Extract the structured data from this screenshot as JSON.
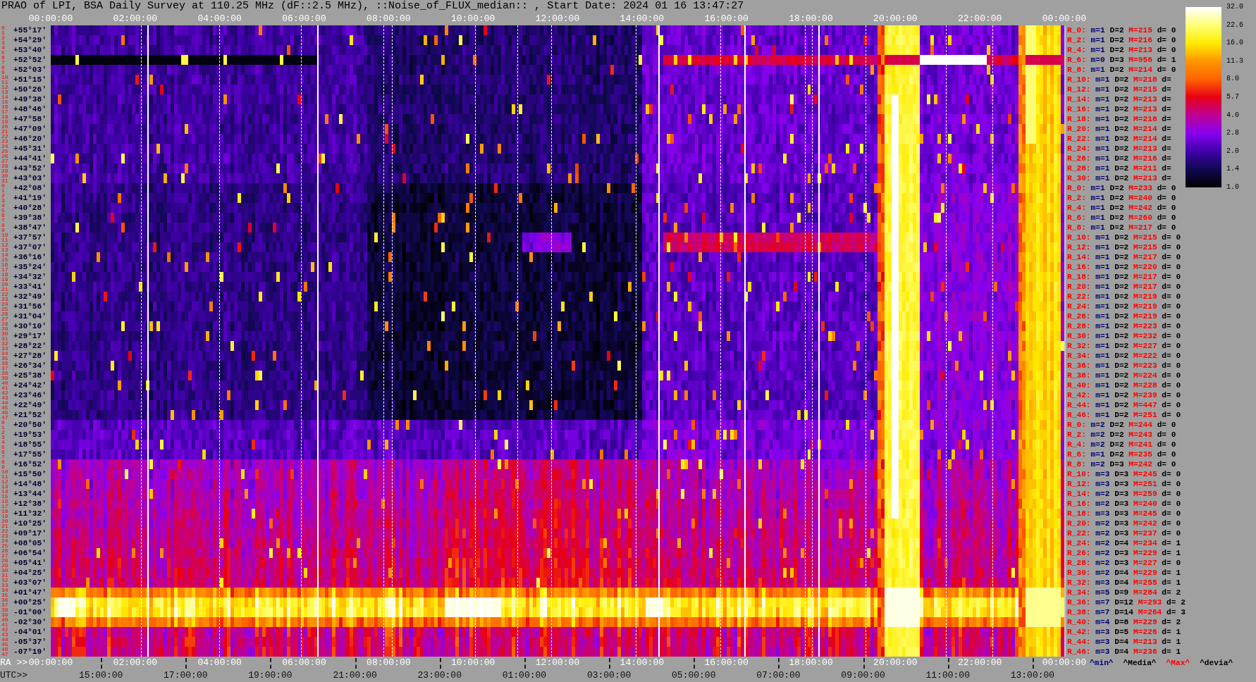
{
  "title": "PRAO of LPI, BSA Daily Survey at 110.25 MHz (dF::2.5 MHz), ::Noise_of_FLUX_median:: , Start Date: 2024 01 16 13:47:27",
  "top_axis": {
    "labels": [
      "00:00:00",
      "02:00:00",
      "04:00:00",
      "06:00:00",
      "08:00:00",
      "10:00:00",
      "12:00:00",
      "14:00:00",
      "16:00:00",
      "18:00:00",
      "20:00:00",
      "22:00:00",
      "00:00:00"
    ]
  },
  "declination_axis": [
    {
      "indices": [
        "0",
        "1"
      ],
      "label": "+55°17'"
    },
    {
      "indices": [
        "2",
        "3"
      ],
      "label": "+54°29'"
    },
    {
      "indices": [
        "4",
        "5"
      ],
      "label": "+53°40'"
    },
    {
      "indices": [
        "6",
        "7"
      ],
      "label": "+52°52'"
    },
    {
      "indices": [
        "8",
        "9"
      ],
      "label": "+52°03'"
    },
    {
      "indices": [
        "10",
        "11"
      ],
      "label": "+51°15'"
    },
    {
      "indices": [
        "12",
        "13"
      ],
      "label": "+50°26'"
    },
    {
      "indices": [
        "14",
        "15"
      ],
      "label": "+49°38'"
    },
    {
      "indices": [
        "16",
        "17"
      ],
      "label": "+48°46'"
    },
    {
      "indices": [
        "18",
        "19"
      ],
      "label": "+47°58'"
    },
    {
      "indices": [
        "20",
        "21"
      ],
      "label": "+47°09'"
    },
    {
      "indices": [
        "22",
        "23"
      ],
      "label": "+46°20'"
    },
    {
      "indices": [
        "24",
        "25"
      ],
      "label": "+45°31'"
    },
    {
      "indices": [
        "26",
        "27"
      ],
      "label": "+44°41'"
    },
    {
      "indices": [
        "28",
        "29"
      ],
      "label": "+43°52'"
    },
    {
      "indices": [
        "30",
        "31"
      ],
      "label": "+43°03'"
    },
    {
      "indices": [
        "0",
        "1"
      ],
      "label": "+42°08'"
    },
    {
      "indices": [
        "2",
        "3"
      ],
      "label": "+41°19'"
    },
    {
      "indices": [
        "4",
        "5"
      ],
      "label": "+40°28'"
    },
    {
      "indices": [
        "6",
        "7"
      ],
      "label": "+39°38'"
    },
    {
      "indices": [
        "8",
        "9"
      ],
      "label": "+38°47'"
    },
    {
      "indices": [
        "10",
        "11"
      ],
      "label": "+37°57'"
    },
    {
      "indices": [
        "12",
        "13"
      ],
      "label": "+37°07'"
    },
    {
      "indices": [
        "14",
        "15"
      ],
      "label": "+36°16'"
    },
    {
      "indices": [
        "16",
        "17"
      ],
      "label": "+35°24'"
    },
    {
      "indices": [
        "18",
        "19"
      ],
      "label": "+34°32'"
    },
    {
      "indices": [
        "20",
        "21"
      ],
      "label": "+33°41'"
    },
    {
      "indices": [
        "22",
        "23"
      ],
      "label": "+32°49'"
    },
    {
      "indices": [
        "24",
        "25"
      ],
      "label": "+31°56'"
    },
    {
      "indices": [
        "26",
        "27"
      ],
      "label": "+31°04'"
    },
    {
      "indices": [
        "28",
        "29"
      ],
      "label": "+30°10'"
    },
    {
      "indices": [
        "30",
        "31"
      ],
      "label": "+29°17'"
    },
    {
      "indices": [
        "32",
        "33"
      ],
      "label": "+28°22'"
    },
    {
      "indices": [
        "34",
        "35"
      ],
      "label": "+27°28'"
    },
    {
      "indices": [
        "36",
        "37"
      ],
      "label": "+26°34'"
    },
    {
      "indices": [
        "38",
        "39"
      ],
      "label": "+25°38'"
    },
    {
      "indices": [
        "40",
        "41"
      ],
      "label": "+24°42'"
    },
    {
      "indices": [
        "42",
        "43"
      ],
      "label": "+23°46'"
    },
    {
      "indices": [
        "44",
        "45"
      ],
      "label": "+22°49'"
    },
    {
      "indices": [
        "46",
        "47"
      ],
      "label": "+21°52'"
    },
    {
      "indices": [
        "0",
        "1"
      ],
      "label": "+20°50'"
    },
    {
      "indices": [
        "2",
        "3"
      ],
      "label": "+19°53'"
    },
    {
      "indices": [
        "4",
        "5"
      ],
      "label": "+18°55'"
    },
    {
      "indices": [
        "6",
        "7"
      ],
      "label": "+17°55'"
    },
    {
      "indices": [
        "8",
        "9"
      ],
      "label": "+16°52'"
    },
    {
      "indices": [
        "10",
        "11"
      ],
      "label": "+15°50'"
    },
    {
      "indices": [
        "12",
        "13"
      ],
      "label": "+14°48'"
    },
    {
      "indices": [
        "14",
        "15"
      ],
      "label": "+13°44'"
    },
    {
      "indices": [
        "16",
        "17"
      ],
      "label": "+12°38'"
    },
    {
      "indices": [
        "18",
        "19"
      ],
      "label": "+11°32'"
    },
    {
      "indices": [
        "20",
        "21"
      ],
      "label": "+10°25'"
    },
    {
      "indices": [
        "22",
        "23"
      ],
      "label": "+09°17'"
    },
    {
      "indices": [
        "24",
        "25"
      ],
      "label": "+08°05'"
    },
    {
      "indices": [
        "26",
        "27"
      ],
      "label": "+06°54'"
    },
    {
      "indices": [
        "28",
        "29"
      ],
      "label": "+05°41'"
    },
    {
      "indices": [
        "30",
        "31"
      ],
      "label": "+04°25'"
    },
    {
      "indices": [
        "32",
        "33"
      ],
      "label": "+03°07'"
    },
    {
      "indices": [
        "34",
        "35"
      ],
      "label": "+01°47'"
    },
    {
      "indices": [
        "36",
        "37"
      ],
      "label": "+00°25'"
    },
    {
      "indices": [
        "38",
        "39"
      ],
      "label": "-01°00'"
    },
    {
      "indices": [
        "40",
        "41"
      ],
      "label": "-02°30'"
    },
    {
      "indices": [
        "42",
        "43"
      ],
      "label": "-04°01'"
    },
    {
      "indices": [
        "44",
        "45"
      ],
      "label": "-05°37'"
    },
    {
      "indices": [
        "46",
        "47"
      ],
      "label": "-07°19'"
    }
  ],
  "beam_stats": [
    {
      "beam": "R_0:",
      "min": "m=1",
      "count": "D=2",
      "max": "M=215",
      "deviation": "d= 0"
    },
    {
      "beam": "R_2:",
      "min": "m=1",
      "count": "D=2",
      "max": "M=216",
      "deviation": "d= 0"
    },
    {
      "beam": "R_4:",
      "min": "m=1",
      "count": "D=2",
      "max": "M=213",
      "deviation": "d= 0"
    },
    {
      "beam": "R_6:",
      "min": "m=0",
      "count": "D=3",
      "max": "M=956",
      "deviation": "d= 1"
    },
    {
      "beam": "R_8:",
      "min": "m=1",
      "count": "D=2",
      "max": "M=214",
      "deviation": "d= 0"
    },
    {
      "beam": "R_10:",
      "min": "m=1",
      "count": "D=2",
      "max": "M=218",
      "deviation": "d="
    },
    {
      "beam": "R_12:",
      "min": "m=1",
      "count": "D=2",
      "max": "M=215",
      "deviation": "d="
    },
    {
      "beam": "R_14:",
      "min": "m=1",
      "count": "D=2",
      "max": "M=213",
      "deviation": "d="
    },
    {
      "beam": "R_16:",
      "min": "m=1",
      "count": "D=2",
      "max": "M=213",
      "deviation": "d="
    },
    {
      "beam": "R_18:",
      "min": "m=1",
      "count": "D=2",
      "max": "M=218",
      "deviation": "d="
    },
    {
      "beam": "R_20:",
      "min": "m=1",
      "count": "D=2",
      "max": "M=214",
      "deviation": "d="
    },
    {
      "beam": "R_22:",
      "min": "m=1",
      "count": "D=2",
      "max": "M=214",
      "deviation": "d="
    },
    {
      "beam": "R_24:",
      "min": "m=1",
      "count": "D=2",
      "max": "M=213",
      "deviation": "d="
    },
    {
      "beam": "R_26:",
      "min": "m=1",
      "count": "D=2",
      "max": "M=216",
      "deviation": "d="
    },
    {
      "beam": "R_28:",
      "min": "m=1",
      "count": "D=2",
      "max": "M=211",
      "deviation": "d="
    },
    {
      "beam": "R_30:",
      "min": "m=1",
      "count": "D=2",
      "max": "M=213",
      "deviation": "d="
    },
    {
      "beam": "R_0:",
      "min": "m=1",
      "count": "D=2",
      "max": "M=233",
      "deviation": "d= 0"
    },
    {
      "beam": "R_2:",
      "min": "m=1",
      "count": "D=2",
      "max": "M=240",
      "deviation": "d= 0"
    },
    {
      "beam": "R_4:",
      "min": "m=1",
      "count": "D=2",
      "max": "M=242",
      "deviation": "d= 0"
    },
    {
      "beam": "R_6:",
      "min": "m=1",
      "count": "D=2",
      "max": "M=260",
      "deviation": "d= 0"
    },
    {
      "beam": "R_8:",
      "min": "m=1",
      "count": "D=2",
      "max": "M=217",
      "deviation": "d= 0"
    },
    {
      "beam": "R_10:",
      "min": "m=1",
      "count": "D=2",
      "max": "M=215",
      "deviation": "d= 0"
    },
    {
      "beam": "R_12:",
      "min": "m=1",
      "count": "D=2",
      "max": "M=215",
      "deviation": "d= 0"
    },
    {
      "beam": "R_14:",
      "min": "m=1",
      "count": "D=2",
      "max": "M=217",
      "deviation": "d= 0"
    },
    {
      "beam": "R_16:",
      "min": "m=1",
      "count": "D=2",
      "max": "M=220",
      "deviation": "d= 0"
    },
    {
      "beam": "R_18:",
      "min": "m=1",
      "count": "D=2",
      "max": "M=217",
      "deviation": "d= 0"
    },
    {
      "beam": "R_20:",
      "min": "m=1",
      "count": "D=2",
      "max": "M=217",
      "deviation": "d= 0"
    },
    {
      "beam": "R_22:",
      "min": "m=1",
      "count": "D=2",
      "max": "M=219",
      "deviation": "d= 0"
    },
    {
      "beam": "R_24:",
      "min": "m=1",
      "count": "D=2",
      "max": "M=219",
      "deviation": "d= 0"
    },
    {
      "beam": "R_26:",
      "min": "m=1",
      "count": "D=2",
      "max": "M=219",
      "deviation": "d= 0"
    },
    {
      "beam": "R_28:",
      "min": "m=1",
      "count": "D=2",
      "max": "M=223",
      "deviation": "d= 0"
    },
    {
      "beam": "R_30:",
      "min": "m=1",
      "count": "D=2",
      "max": "M=232",
      "deviation": "d= 0"
    },
    {
      "beam": "R_32:",
      "min": "m=1",
      "count": "D=2",
      "max": "M=227",
      "deviation": "d= 0"
    },
    {
      "beam": "R_34:",
      "min": "m=1",
      "count": "D=2",
      "max": "M=222",
      "deviation": "d= 0"
    },
    {
      "beam": "R_36:",
      "min": "m=1",
      "count": "D=2",
      "max": "M=223",
      "deviation": "d= 0"
    },
    {
      "beam": "R_38:",
      "min": "m=1",
      "count": "D=2",
      "max": "M=224",
      "deviation": "d= 0"
    },
    {
      "beam": "R_40:",
      "min": "m=1",
      "count": "D=2",
      "max": "M=228",
      "deviation": "d= 0"
    },
    {
      "beam": "R_42:",
      "min": "m=1",
      "count": "D=2",
      "max": "M=239",
      "deviation": "d= 0"
    },
    {
      "beam": "R_44:",
      "min": "m=1",
      "count": "D=2",
      "max": "M=447",
      "deviation": "d= 0"
    },
    {
      "beam": "R_46:",
      "min": "m=1",
      "count": "D=2",
      "max": "M=251",
      "deviation": "d= 0"
    },
    {
      "beam": "R_0:",
      "min": "m=2",
      "count": "D=2",
      "max": "M=244",
      "deviation": "d= 0"
    },
    {
      "beam": "R_2:",
      "min": "m=2",
      "count": "D=2",
      "max": "M=243",
      "deviation": "d= 0"
    },
    {
      "beam": "R_4:",
      "min": "m=2",
      "count": "D=2",
      "max": "M=241",
      "deviation": "d= 0"
    },
    {
      "beam": "R_6:",
      "min": "m=1",
      "count": "D=2",
      "max": "M=235",
      "deviation": "d= 0"
    },
    {
      "beam": "R_8:",
      "min": "m=2",
      "count": "D=3",
      "max": "M=242",
      "deviation": "d= 0"
    },
    {
      "beam": "R_10:",
      "min": "m=3",
      "count": "D=3",
      "max": "M=245",
      "deviation": "d= 0"
    },
    {
      "beam": "R_12:",
      "min": "m=3",
      "count": "D=3",
      "max": "M=251",
      "deviation": "d= 0"
    },
    {
      "beam": "R_14:",
      "min": "m=2",
      "count": "D=3",
      "max": "M=259",
      "deviation": "d= 0"
    },
    {
      "beam": "R_16:",
      "min": "m=2",
      "count": "D=3",
      "max": "M=240",
      "deviation": "d= 0"
    },
    {
      "beam": "R_18:",
      "min": "m=3",
      "count": "D=3",
      "max": "M=245",
      "deviation": "d= 0"
    },
    {
      "beam": "R_20:",
      "min": "m=2",
      "count": "D=3",
      "max": "M=242",
      "deviation": "d= 0"
    },
    {
      "beam": "R_22:",
      "min": "m=2",
      "count": "D=3",
      "max": "M=237",
      "deviation": "d= 0"
    },
    {
      "beam": "R_24:",
      "min": "m=2",
      "count": "D=4",
      "max": "M=234",
      "deviation": "d= 1"
    },
    {
      "beam": "R_26:",
      "min": "m=2",
      "count": "D=3",
      "max": "M=229",
      "deviation": "d= 1"
    },
    {
      "beam": "R_28:",
      "min": "m=2",
      "count": "D=3",
      "max": "M=227",
      "deviation": "d= 0"
    },
    {
      "beam": "R_30:",
      "min": "m=2",
      "count": "D=4",
      "max": "M=229",
      "deviation": "d= 1"
    },
    {
      "beam": "R_32:",
      "min": "m=3",
      "count": "D=4",
      "max": "M=255",
      "deviation": "d= 1"
    },
    {
      "beam": "R_34:",
      "min": "m=5",
      "count": "D=9",
      "max": "M=284",
      "deviation": "d= 2"
    },
    {
      "beam": "R_36:",
      "min": "m=7",
      "count": "D=12",
      "max": "M=293",
      "deviation": "d= 2"
    },
    {
      "beam": "R_38:",
      "min": "m=7",
      "count": "D=14",
      "max": "M=264",
      "deviation": "d= 3"
    },
    {
      "beam": "R_40:",
      "min": "m=4",
      "count": "D=8",
      "max": "M=229",
      "deviation": "d= 2"
    },
    {
      "beam": "R_42:",
      "min": "m=3",
      "count": "D=5",
      "max": "M=226",
      "deviation": "d= 1"
    },
    {
      "beam": "R_44:",
      "min": "m=3",
      "count": "D=4",
      "max": "M=213",
      "deviation": "d= 1"
    },
    {
      "beam": "R_46:",
      "min": "m=3",
      "count": "D=4",
      "max": "M=236",
      "deviation": "d= 1"
    }
  ],
  "colorbar": {
    "ticks": [
      "32.0",
      "22.6",
      "16.0",
      "11.3",
      "8.0",
      "5.7",
      "4.0",
      "2.8",
      "2.0",
      "1.4",
      "1.0"
    ]
  },
  "bottom_axis": {
    "ra_prefix": "RA >>",
    "ra_labels": [
      "00:00:00",
      "02:00:00",
      "04:00:00",
      "06:00:00",
      "08:00:00",
      "10:00:00",
      "12:00:00",
      "14:00:00",
      "16:00:00",
      "18:00:00",
      "20:00:00",
      "22:00:00",
      "00:00:00"
    ],
    "utc_prefix": "UTC>>",
    "utc_labels": [
      "15:00:00",
      "17:00:00",
      "19:00:00",
      "21:00:00",
      "23:00:00",
      "01:00:00",
      "03:00:00",
      "05:00:00",
      "07:00:00",
      "09:00:00",
      "11:00:00",
      "13:00:00"
    ]
  },
  "legend": [
    {
      "text": "^min^",
      "color": "#000080"
    },
    {
      "text": "^Media^",
      "color": "#000000"
    },
    {
      "text": "^Max^",
      "color": "#ff0000"
    },
    {
      "text": "^devia^",
      "color": "#000000"
    }
  ]
}
